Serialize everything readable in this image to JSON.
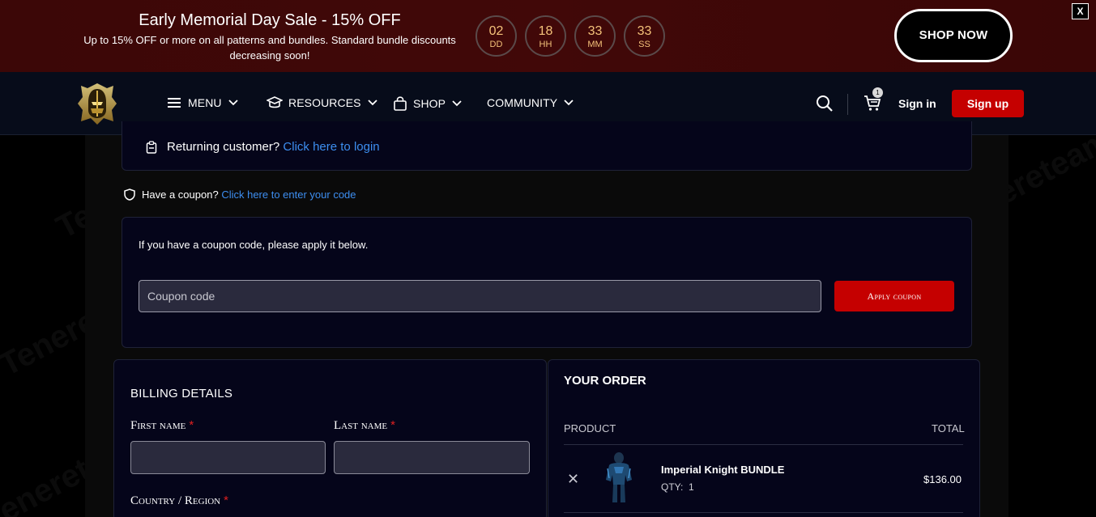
{
  "promo": {
    "title": "Early Memorial Day Sale - 15% OFF",
    "subtitle": "Up to 15% OFF or more on all patterns and bundles. Standard bundle discounts decreasing soon!",
    "countdown": [
      {
        "value": "02",
        "unit": "DD"
      },
      {
        "value": "18",
        "unit": "HH"
      },
      {
        "value": "33",
        "unit": "MM"
      },
      {
        "value": "33",
        "unit": "SS"
      }
    ],
    "shop_now": "SHOP NOW",
    "close": "X"
  },
  "nav": {
    "items": [
      {
        "label": "MENU",
        "icon": "hamburger-icon"
      },
      {
        "label": "RESOURCES",
        "icon": "graduation-cap-icon"
      },
      {
        "label": "SHOP",
        "icon": "shopping-bag-icon"
      },
      {
        "label": "COMMUNITY",
        "icon": ""
      }
    ],
    "cart_count": "1",
    "sign_in": "Sign in",
    "sign_up": "Sign up"
  },
  "checkout": {
    "returning_text": "Returning customer?",
    "returning_link": "Click here to login",
    "coupon_text": "Have a coupon?",
    "coupon_link": "Click here to enter your code",
    "coupon_instructions": "If you have a coupon code, please apply it below.",
    "coupon_placeholder": "Coupon code",
    "apply_button": "Apply coupon"
  },
  "billing": {
    "title": "BILLING DETAILS",
    "first_name_label": "First name",
    "last_name_label": "Last name",
    "country_label": "Country / Region",
    "required_mark": "*"
  },
  "order": {
    "title": "YOUR ORDER",
    "col_product": "PRODUCT",
    "col_total": "TOTAL",
    "items": [
      {
        "name": "Imperial Knight BUNDLE",
        "qty_label": "QTY:",
        "qty": "1",
        "total": "$136.00"
      }
    ],
    "remove_symbol": "✕"
  },
  "watermark": "Tenereteam",
  "colors": {
    "promo_bg": "#3c0707",
    "nav_bg": "#070c1a",
    "accent_red": "#c50000",
    "link_blue": "#3d8ef0",
    "countdown_gold": "#f4c27a",
    "panel_bg": "#05051a"
  }
}
